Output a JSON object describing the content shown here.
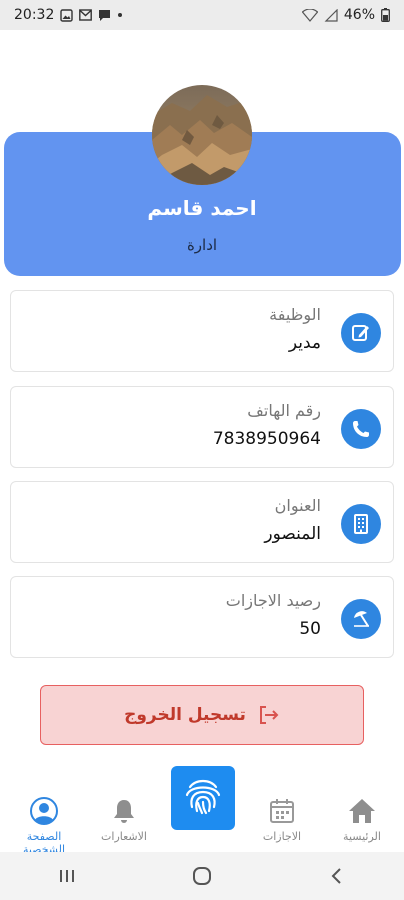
{
  "status_bar": {
    "time": "20:32",
    "battery": "46%"
  },
  "profile": {
    "name": "احمد قاسم",
    "department": "ادارة"
  },
  "info_cards": [
    {
      "label": "الوظيفة",
      "value": "مدير",
      "icon": "edit-icon"
    },
    {
      "label": "رقم الهاتف",
      "value": "7838950964",
      "icon": "phone-icon"
    },
    {
      "label": "العنوان",
      "value": "المنصور",
      "icon": "building-icon"
    },
    {
      "label": "رصيد الاجازات",
      "value": "50",
      "icon": "beach-umbrella-icon"
    }
  ],
  "logout": {
    "label": "تسجيل الخروج"
  },
  "bottom_nav": {
    "home": "الرئيسية",
    "leaves": "الاجازات",
    "notifications": "الاشعارات",
    "profile": "الصفحة الشخصية"
  },
  "colors": {
    "accent": "#2f86e0",
    "card_blue": "#6294f0",
    "logout_bg": "#f8d3d3",
    "logout_border": "#e76060"
  }
}
